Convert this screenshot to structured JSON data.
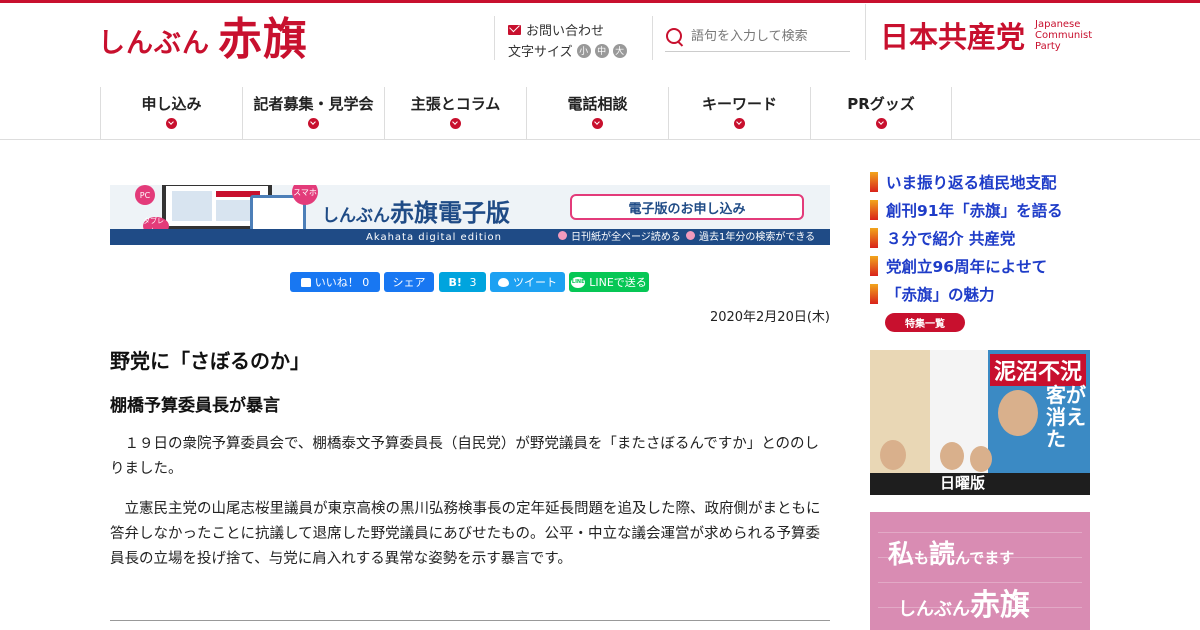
{
  "header": {
    "logo_small": "しんぶん",
    "logo_big": "赤旗",
    "contact_label": "お問い合わせ",
    "fontsize_label": "文字サイズ",
    "fontsize_options": [
      "小",
      "中",
      "大"
    ],
    "search_placeholder": "語句を入力して検索",
    "jcp_name": "日本共産党",
    "jcp_en_lines": [
      "Japanese",
      "Communist",
      "Party"
    ]
  },
  "nav": {
    "items": [
      {
        "label": "申し込み"
      },
      {
        "label": "記者募集・見学会"
      },
      {
        "label": "主張とコラム"
      },
      {
        "label": "電話相談"
      },
      {
        "label": "キーワード"
      },
      {
        "label": "PRグッズ"
      }
    ]
  },
  "banner": {
    "pc": "PC",
    "tablet": "タブレット",
    "smartphone": "スマホ",
    "title_small": "しんぶん",
    "title_big": "赤旗電子版",
    "subtitle": "Akahata digital edition",
    "apply_button": "電子版のお申し込み",
    "feature1": "日刊紙が全ページ読める",
    "feature2": "過去1年分の検索ができる"
  },
  "social": {
    "like_label": "いいね！",
    "like_count": "0",
    "share_label": "シェア",
    "hatebu_label": "B!",
    "hatebu_count": "3",
    "tweet_label": "ツイート",
    "line_label": "LINEで送る",
    "line_icon_text": "LINE"
  },
  "article": {
    "date": "2020年2月20日(木)",
    "headline": "野党に「さぼるのか」",
    "subhead": "棚橋予算委員長が暴言",
    "paragraphs": [
      "　１９日の衆院予算委員会で、棚橋泰文予算委員長（自民党）が野党議員を「またさぼるんですか」とののしりました。",
      "　立憲民主党の山尾志桜里議員が東京高検の黒川弘務検事長の定年延長問題を追及した際、政府側がまともに答弁しなかったことに抗議して退席した野党議員にあびせたもの。公平・中立な議会運営が求められる予算委員長の立場を投げ捨て、与党に肩入れする異常な姿勢を示す暴言です。"
    ]
  },
  "sidebar": {
    "links": [
      {
        "label": "いま振り返る植民地支配"
      },
      {
        "label": "創刊91年「赤旗」を語る"
      },
      {
        "label": "３分で紹介 共産党"
      },
      {
        "label": "党創立96周年によせて"
      },
      {
        "label": "「赤旗」の魅力"
      }
    ],
    "more_button": "特集一覧",
    "magazine_headline": "泥沼不況",
    "magazine_sub": "客が消えた",
    "magazine_band": "日曜版",
    "promo_line1_a": "私",
    "promo_line1_b": "も",
    "promo_line1_c": "読",
    "promo_line1_d": "んでます",
    "promo_line2_a": "しんぶん",
    "promo_line2_b": "赤旗"
  },
  "colors": {
    "brand_red": "#c8102e",
    "link_blue": "#1e3cc8",
    "banner_navy": "#1f4b86",
    "facebook": "#1877f2",
    "line_green": "#06c755"
  }
}
